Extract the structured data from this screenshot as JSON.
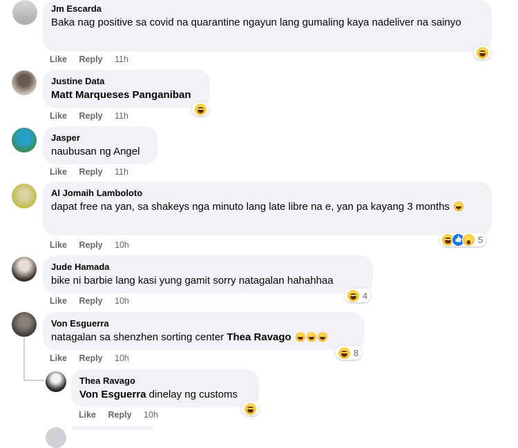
{
  "actions": {
    "like": "Like",
    "reply": "Reply"
  },
  "comments": [
    {
      "author": "Jm Escarda",
      "text": "Baka nag positive sa covid na quarantine ngayun lang gumaling kaya nadeliver na sainyo",
      "time": "11h",
      "react_count": ""
    },
    {
      "author": "Justine Data",
      "mention": "Matt Marqueses Panganiban",
      "time": "11h",
      "react_count": ""
    },
    {
      "author": "Jasper",
      "text": "naubusan ng Angel",
      "time": "11h"
    },
    {
      "author": "Al Jomaih Lamboloto",
      "text": "dapat free na yan, sa shakeys nga minuto lang late libre na e, yan pa kayang 3 months",
      "time": "10h",
      "react_count": "5"
    },
    {
      "author": "Jude Hamada",
      "text": "bike ni barbie lang kasi yung gamit sorry natagalan hahahhaa",
      "time": "10h",
      "react_count": "4"
    },
    {
      "author": "Von Esguerra",
      "text": "natagalan sa shenzhen sorting center",
      "mention": "Thea Ravago",
      "time": "10h",
      "react_count": "8"
    },
    {
      "author": "Thea Ravago",
      "mention": "Von Esguerra",
      "text": "dinelay ng customs",
      "time": "10h"
    }
  ],
  "colors": {
    "bubble": "#f0f2f5",
    "meta": "#65676b",
    "text": "#050505"
  }
}
